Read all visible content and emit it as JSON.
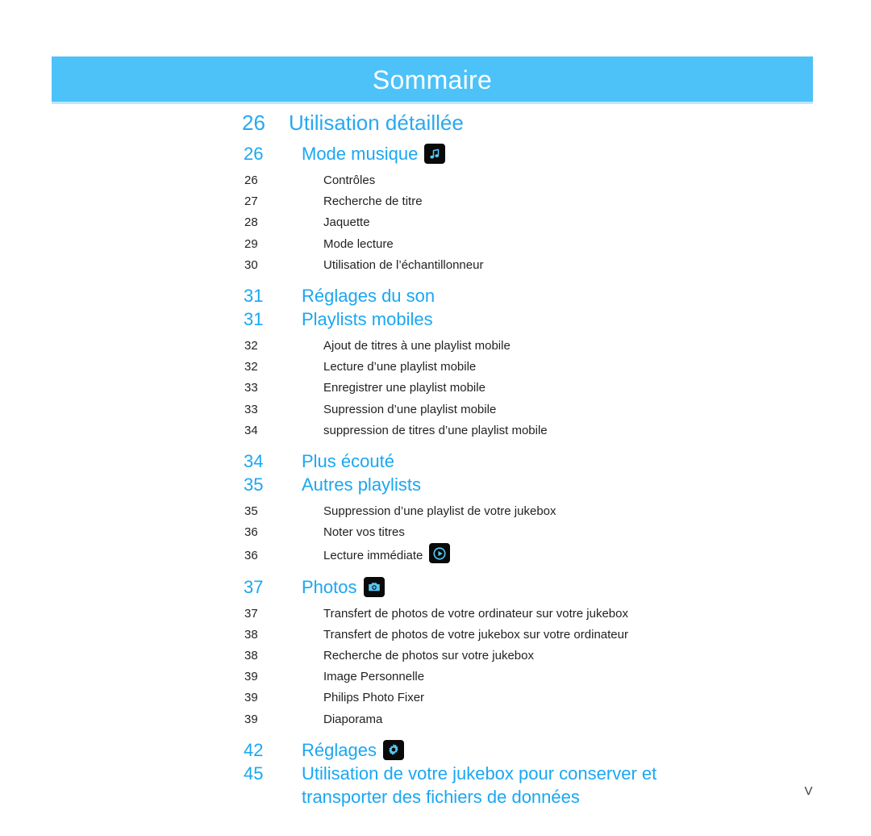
{
  "header": {
    "title": "Sommaire",
    "band_color": "#4cc2f9",
    "title_color": "#ffffff"
  },
  "colors": {
    "heading_blue": "#29a8f0",
    "subheading_blue": "#1aa7f2",
    "body_black": "#231f20",
    "badge_bg": "#0a0a0a",
    "badge_glyph": "#56c8f5"
  },
  "toc": {
    "section": {
      "number": "26",
      "title": "Utilisation détaillée"
    },
    "entries": [
      {
        "level": 2,
        "number": "26",
        "label": "Mode musique",
        "icon": "music-note-icon"
      },
      {
        "level": 3,
        "number": "26",
        "label": "Contrôles"
      },
      {
        "level": 3,
        "number": "27",
        "label": "Recherche de titre"
      },
      {
        "level": 3,
        "number": "28",
        "label": "Jaquette"
      },
      {
        "level": 3,
        "number": "29",
        "label": "Mode lecture"
      },
      {
        "level": 3,
        "number": "30",
        "label": "Utilisation de l’échantillonneur"
      },
      {
        "level": 2,
        "number": "31",
        "label": "Réglages du son"
      },
      {
        "level": 2,
        "number": "31",
        "label": "Playlists mobiles"
      },
      {
        "level": 3,
        "number": "32",
        "label": "Ajout de titres à une playlist mobile"
      },
      {
        "level": 3,
        "number": "32",
        "label": "Lecture d’une playlist mobile"
      },
      {
        "level": 3,
        "number": "33",
        "label": "Enregistrer une playlist mobile"
      },
      {
        "level": 3,
        "number": "33",
        "label": "Supression d’une playlist mobile"
      },
      {
        "level": 3,
        "number": "34",
        "label": "suppression de titres d’une playlist mobile"
      },
      {
        "level": 2,
        "number": "34",
        "label": "Plus écouté"
      },
      {
        "level": 2,
        "number": "35",
        "label": "Autres playlists"
      },
      {
        "level": 3,
        "number": "35",
        "label": "Suppression d’une playlist de votre jukebox"
      },
      {
        "level": 3,
        "number": "36",
        "label": "Noter vos titres"
      },
      {
        "level": 3,
        "number": "36",
        "label": "Lecture immédiate",
        "icon": "play-circle-icon"
      },
      {
        "level": 2,
        "number": "37",
        "label": "Photos",
        "icon": "camera-icon"
      },
      {
        "level": 3,
        "number": "37",
        "label": "Transfert de photos de votre ordinateur sur votre jukebox"
      },
      {
        "level": 3,
        "number": "38",
        "label": "Transfert de photos de votre jukebox sur votre ordinateur"
      },
      {
        "level": 3,
        "number": "38",
        "label": "Recherche de photos sur votre jukebox"
      },
      {
        "level": 3,
        "number": "39",
        "label": "Image Personnelle"
      },
      {
        "level": 3,
        "number": "39",
        "label": "Philips Photo Fixer"
      },
      {
        "level": 3,
        "number": "39",
        "label": "Diaporama"
      },
      {
        "level": 2,
        "number": "42",
        "label": "Réglages",
        "icon": "gear-icon"
      },
      {
        "level": 2,
        "number": "45",
        "label": "Utilisation de votre jukebox pour conserver et",
        "label_line2": "transporter des fichiers de données"
      }
    ]
  },
  "folio": {
    "page": "V"
  }
}
